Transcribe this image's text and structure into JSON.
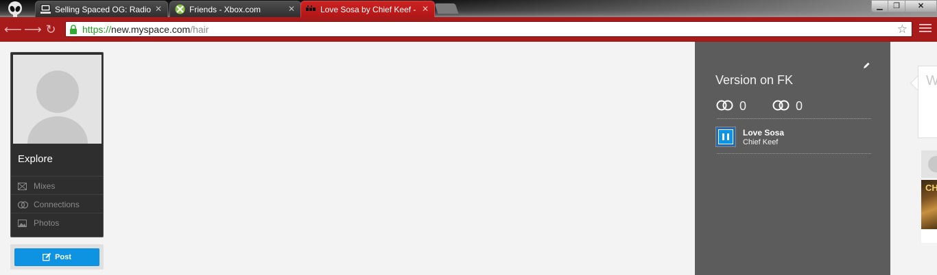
{
  "browser": {
    "tabs": [
      {
        "title": "Selling Spaced OG: Radio",
        "favicon": "computer-icon"
      },
      {
        "title": "Friends - Xbox.com",
        "favicon": "xbox-icon"
      },
      {
        "title": "Love Sosa by Chief Keef -",
        "favicon": "myspace-icon",
        "active": true
      }
    ],
    "close_glyph": "✕",
    "window": {
      "minimize": "▁",
      "maximize": "❐",
      "close": "✕"
    },
    "url": {
      "scheme": "https://",
      "host": "new.myspace.com",
      "path": "/hair"
    },
    "nav": {
      "back": "⟵",
      "forward": "⟶",
      "reload": "↻"
    },
    "star": "☆",
    "colors": {
      "toolbar": "#a81b1b",
      "active_tab": "#c22222"
    }
  },
  "sidebar": {
    "title": "Explore",
    "items": [
      {
        "label": "Mixes",
        "icon": "mixes-icon"
      },
      {
        "label": "Connections",
        "icon": "connections-icon"
      },
      {
        "label": "Photos",
        "icon": "photos-icon"
      }
    ],
    "post_label": "Post",
    "post_color": "#0d93e2"
  },
  "panel": {
    "title": "Version on FK",
    "stats": [
      {
        "icon": "connections-icon",
        "value": "0"
      },
      {
        "icon": "connections-icon",
        "value": "0"
      }
    ],
    "track": {
      "title": "Love Sosa",
      "artist": "Chief Keef",
      "state": "playing"
    }
  },
  "right": {
    "search_placeholder": "W",
    "album_text": "CHI"
  }
}
